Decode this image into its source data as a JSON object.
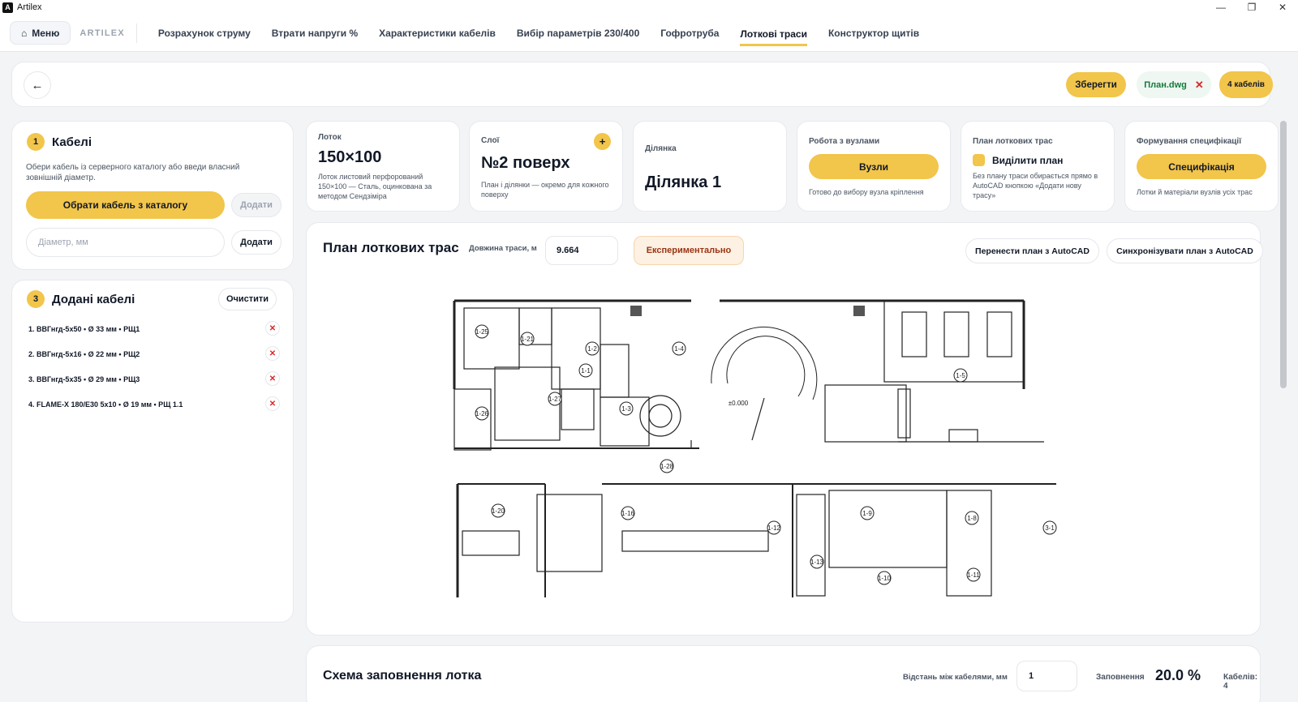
{
  "window": {
    "title": "Artilex",
    "controls": [
      "—",
      "❐",
      "✕"
    ]
  },
  "nav": {
    "menu_label": "Меню",
    "brand": "ARTILEX",
    "tabs": [
      "Розрахунок струму",
      "Втрати напруги %",
      "Характеристики кабелів",
      "Вибір параметрів 230/400",
      "Гофротруба",
      "Лоткові траси",
      "Конструктор щитів"
    ],
    "active_tab": "Лоткові траси"
  },
  "topbar": {
    "back": "←",
    "save_label": "Зберегти",
    "file_name": "План.dwg",
    "file_remove": "✕",
    "cable_count": "4 кабелів"
  },
  "cables": {
    "step": "1",
    "title": "Кабелі",
    "helper": "Обери кабель із серверного каталогу або введи власний зовнішній діаметр.",
    "catalog_btn": "Обрати кабель з каталогу",
    "add_disabled": "Додати",
    "diameter_placeholder": "Діаметр, мм",
    "add_label": "Додати"
  },
  "added": {
    "step": "3",
    "title": "Додані кабелі",
    "clear_label": "Очистити",
    "items": [
      "1. ВВГнгд-5х50  •  Ø 33 мм • РЩ1",
      "2. ВВГнгд-5х16  •  Ø 22 мм • РЩ2",
      "3. ВВГнгд-5х35  •  Ø 29 мм • РЩ3",
      "4. FLAME-X 180/E30 5x10  •  Ø 19 мм • РЩ 1.1"
    ]
  },
  "info_cards": {
    "tray": {
      "label": "Лоток",
      "value": "150×100",
      "desc": "Лоток листовий перфорований 150×100 — Сталь, оцинкована за методом Сендзіміра"
    },
    "layers": {
      "label": "Слої",
      "value": "№2 поверх",
      "desc": "План і ділянки — окремо для кожного поверху",
      "add": "+"
    },
    "section": {
      "label": "Ділянка",
      "value": "Ділянка 1"
    },
    "nodes": {
      "label": "Робота з вузлами",
      "btn": "Вузли",
      "desc": "Готово до вибору вузла кріплення"
    },
    "plan": {
      "label": "План лоткових трас",
      "check_label": "Виділити план",
      "desc": "Без плану траси обирається прямо в AutoCAD кнопкою «Додати нову трасу»"
    },
    "spec": {
      "label": "Формування специфікації",
      "btn": "Специфікація",
      "desc": "Лотки й матеріали вузлів усіх трас"
    }
  },
  "plan": {
    "title": "План лоткових трас",
    "length_label": "Довжина траси, м",
    "length_value": "9.664",
    "badge": "Експериментально",
    "move_btn": "Перенести план з AutoCAD",
    "sync_btn": "Синхронізувати план з AutoCAD",
    "room_labels": [
      "1-25",
      "1-21",
      "1-2",
      "1-1",
      "1-4",
      "1-26",
      "1-27",
      "1-3",
      "±0.000",
      "1-5",
      "1-28",
      "1-20",
      "1-16",
      "1-12",
      "1-9",
      "1-8",
      "3-1",
      "1-13",
      "1-10",
      "1-11"
    ]
  },
  "fill": {
    "title": "Схема заповнення лотка",
    "gap_label": "Відстань між кабелями, мм",
    "gap_value": "1",
    "fill_label": "Заповнення",
    "fill_value": "20.0 %",
    "count_label": "Кабелів: 4"
  },
  "colors": {
    "accent": "#f2c54b",
    "file_green": "#137a3d",
    "danger": "#dc2626",
    "badge_bg": "#fdf1e3"
  }
}
